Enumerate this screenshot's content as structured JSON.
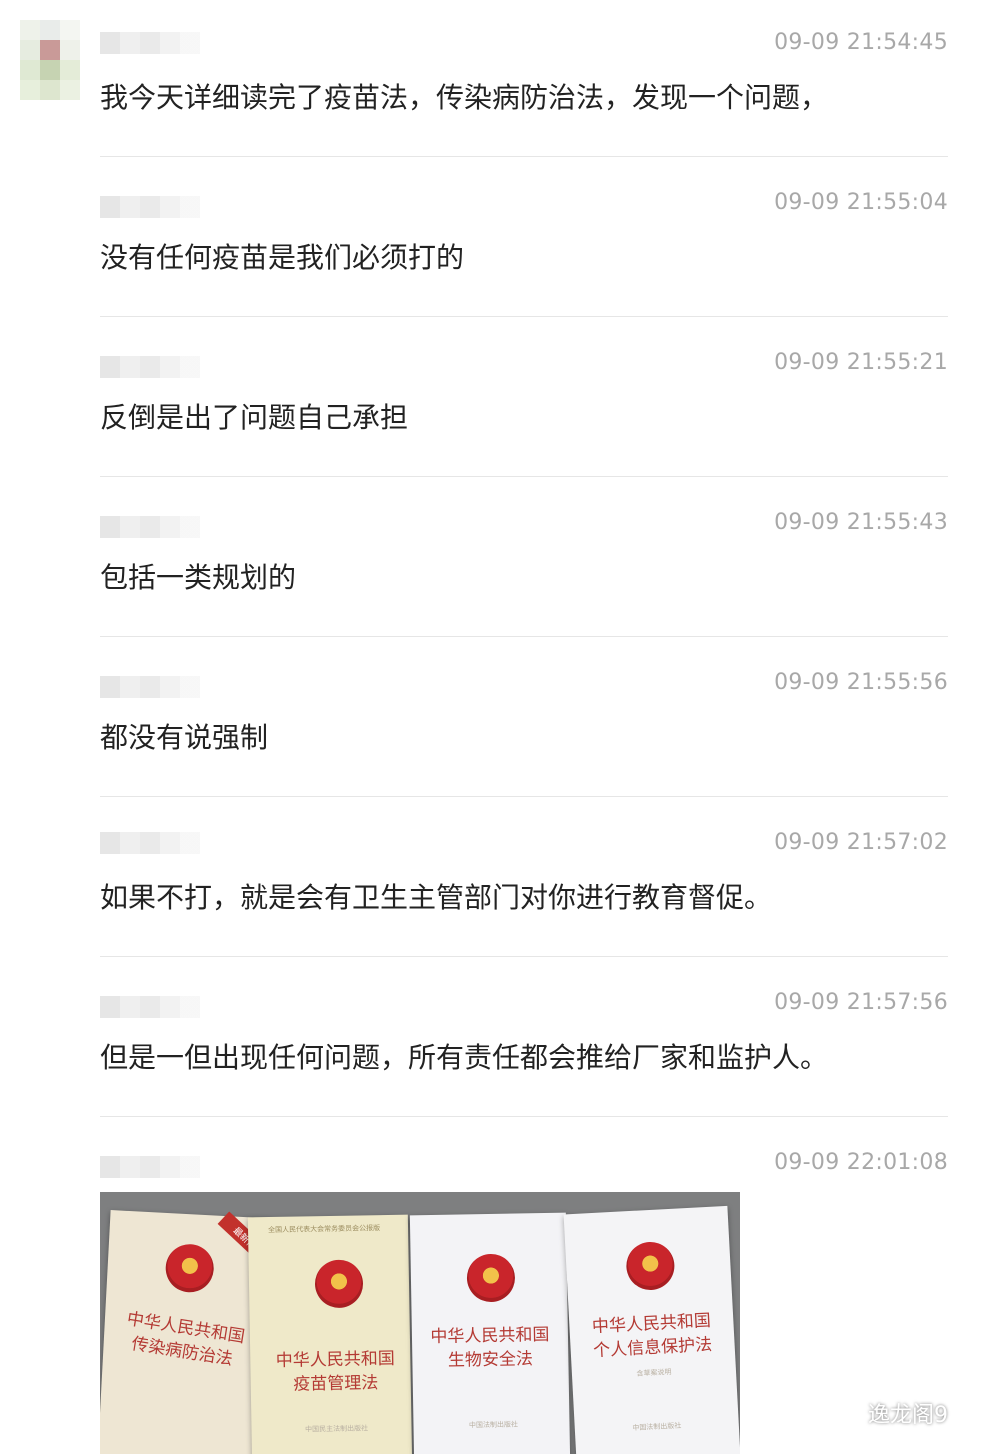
{
  "messages": [
    {
      "time": "09-09 21:54:45",
      "text": "我今天详细读完了疫苗法，传染病防治法，发现一个问题，"
    },
    {
      "time": "09-09 21:55:04",
      "text": "没有任何疫苗是我们必须打的"
    },
    {
      "time": "09-09 21:55:21",
      "text": "反倒是出了问题自己承担"
    },
    {
      "time": "09-09 21:55:43",
      "text": "包括一类规划的"
    },
    {
      "time": "09-09 21:55:56",
      "text": "都没有说强制"
    },
    {
      "time": "09-09 21:57:02",
      "text": "如果不打，就是会有卫生主管部门对你进行教育督促。"
    },
    {
      "time": "09-09 21:57:56",
      "text": "但是一但出现任何问题，所有责任都会推给厂家和监护人。"
    },
    {
      "time": "09-09 22:01:08",
      "text": ""
    }
  ],
  "photo": {
    "books": [
      {
        "title_line1": "中华人民共和国",
        "title_line2": "传染病防治法",
        "ribbon": "最新修正版",
        "publisher": ""
      },
      {
        "title_line1": "中华人民共和国",
        "title_line2": "疫苗管理法",
        "top_text": "全国人民代表大会常务委员会公报版",
        "publisher": "中国民主法制出版社"
      },
      {
        "title_line1": "中华人民共和国",
        "title_line2": "生物安全法",
        "publisher": "中国法制出版社"
      },
      {
        "title_line1": "中华人民共和国",
        "title_line2": "个人信息保护法",
        "subtitle": "含草案说明",
        "publisher": "中国法制出版社"
      }
    ]
  },
  "watermark": {
    "text": "逸龙阁9",
    "icon": "wechat-icon"
  }
}
